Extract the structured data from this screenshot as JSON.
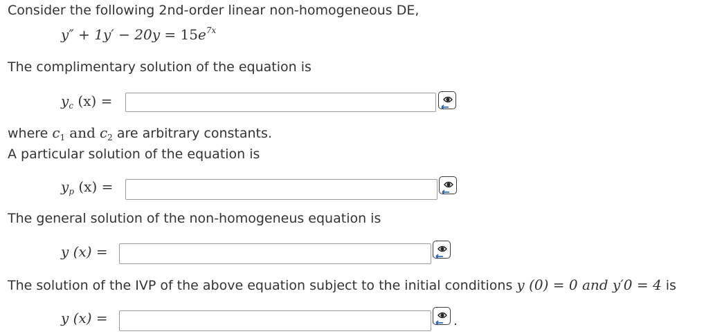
{
  "intro": "Consider the following 2nd-order linear non-homogeneous DE,",
  "equation": {
    "lhs": "y″ + 1y′ − 20y =",
    "coef": "15",
    "base": "e",
    "exponent": "7x"
  },
  "q1": {
    "prompt": "The complimentary solution of the equation is",
    "label_var": "y",
    "label_sub": "c",
    "label_rest": "(x) =",
    "value": ""
  },
  "constants_note": {
    "where": "where",
    "c1": "c",
    "c1_sub": "1",
    "and": "and",
    "c2": "c",
    "c2_sub": "2",
    "rest": "are arbitrary constants."
  },
  "q2": {
    "prompt": "A particular solution of the equation is",
    "label_var": "y",
    "label_sub": "p",
    "label_rest": "(x) =",
    "value": ""
  },
  "q3": {
    "prompt": "The general solution of the non-homogeneus equation is",
    "label": "y (x) =",
    "value": ""
  },
  "q4": {
    "prompt": "The solution of the IVP of the above equation subject to the initial conditions",
    "condition": "y (0) = 0 and y′0 = 4",
    "prompt_end": "is",
    "label": "y (x) =",
    "value": "",
    "trailing": "."
  },
  "icons": [
    "equation-editor-icon",
    "equation-editor-icon",
    "equation-editor-icon",
    "equation-editor-icon"
  ]
}
